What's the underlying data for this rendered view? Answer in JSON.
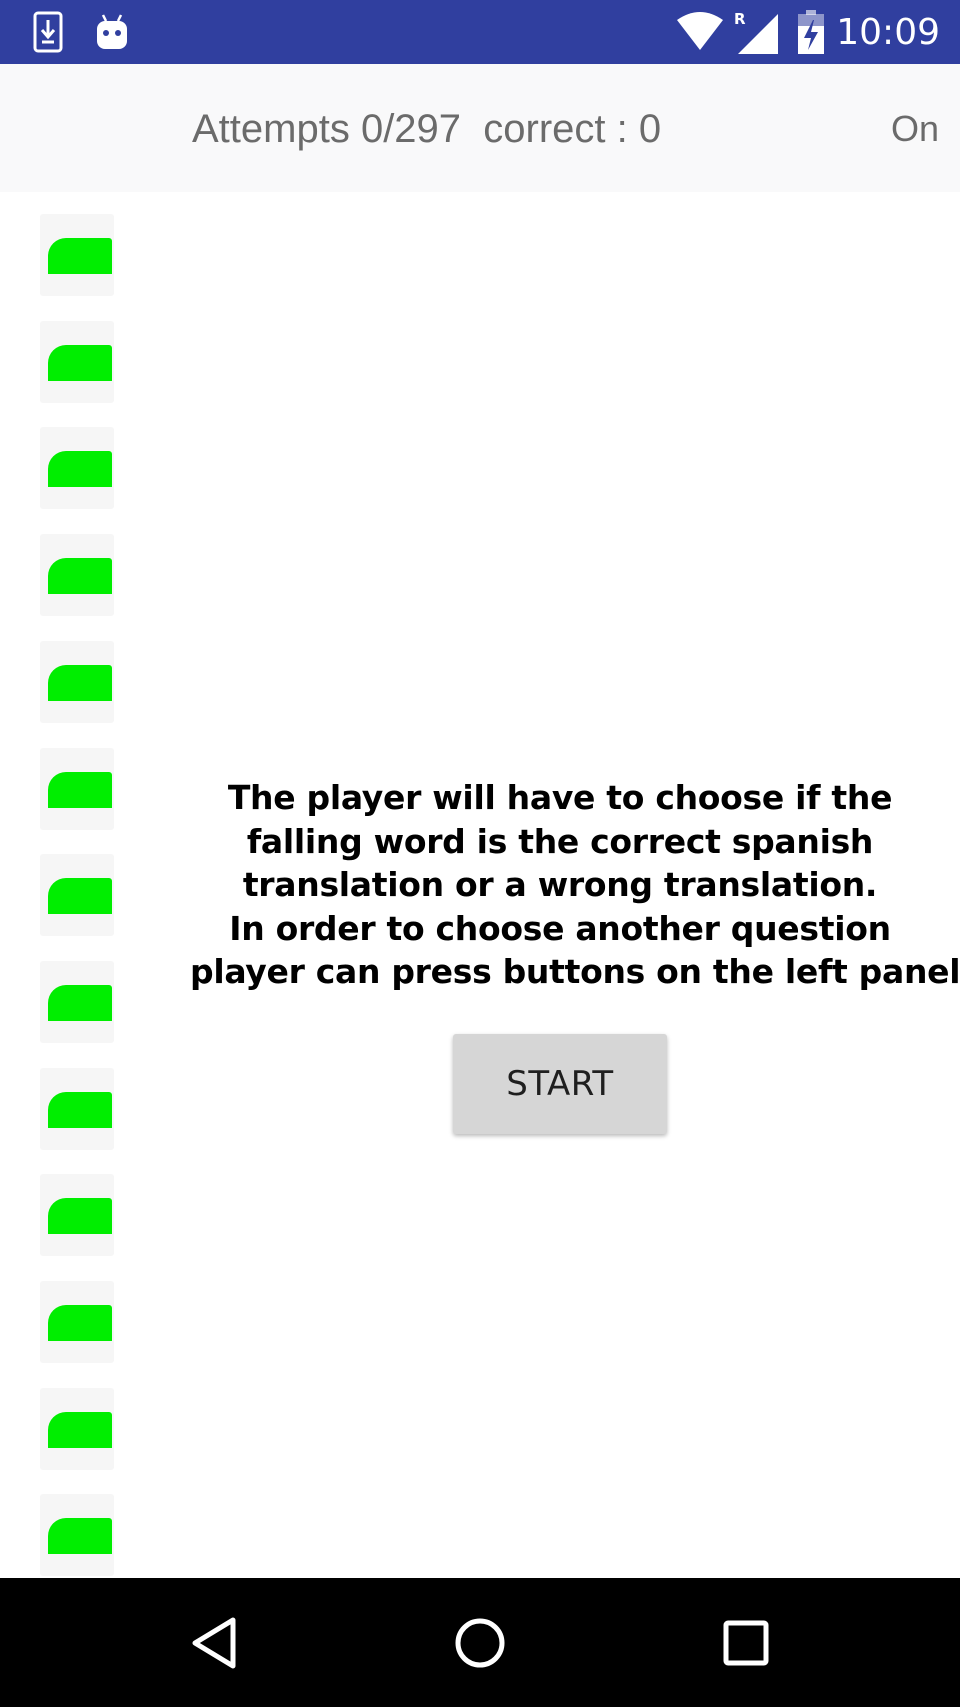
{
  "status_bar": {
    "time": "10:09",
    "background_color": "#303F9F",
    "left_icons": [
      "download-notification-icon",
      "android-notification-icon"
    ],
    "right_icons": [
      "wifi-icon",
      "signal-roaming-icon",
      "battery-charging-icon"
    ],
    "roaming_indicator": "R"
  },
  "top_bar": {
    "attempts_text": "Attempts 0/297  correct : 0",
    "toggle_text": "On"
  },
  "left_panel": {
    "button_count": 13,
    "button_color": "#00ee00"
  },
  "instructions": {
    "lines": [
      "The player will have to choose if the",
      "falling word is the correct spanish",
      "translation or a wrong translation.",
      "In order to choose another question",
      "player can press buttons on the left panel."
    ]
  },
  "start_button": {
    "label": "START"
  },
  "nav_bar": {
    "buttons": [
      "back-icon",
      "home-icon",
      "recents-icon"
    ]
  }
}
